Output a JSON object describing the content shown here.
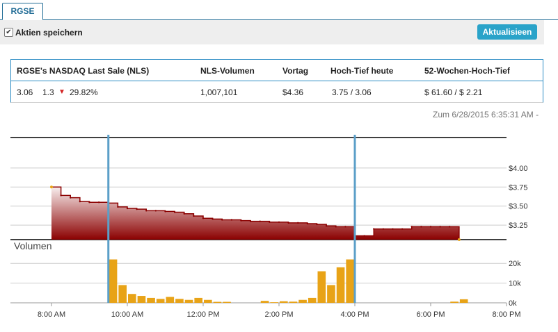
{
  "tab": {
    "label": "RGSE"
  },
  "toolbar": {
    "checkbox_label": "Aktien speichern",
    "checked": true,
    "refresh_label": "Aktualisieen"
  },
  "quote": {
    "headers": [
      "RGSE's NASDAQ Last Sale (NLS)",
      "NLS-Volumen",
      "Vortag",
      "Hoch-Tief heute",
      "52-Wochen-Hoch-Tief"
    ],
    "last": "3.06",
    "change": "1.3",
    "change_pct": "29.82%",
    "volume": "1,007,101",
    "prev_close": "$4.36",
    "day_range": "3.75 / 3.06",
    "week52_range": "$ 61.60 / $ 2.21"
  },
  "as_of": "Zum 6/28/2015 6:35:31 AM -",
  "colors": {
    "accent": "#1f6b95",
    "button": "#2aa3c9",
    "price_fill_dark": "#8b0000",
    "price_fill_light": "#f8eeee",
    "volume_bars": "#e8a317",
    "session_marker": "#5b9fc8",
    "down": "#d32222"
  },
  "chart_data": [
    {
      "type": "area",
      "title": "",
      "x": [
        "08:00",
        "08:15",
        "08:30",
        "08:45",
        "09:00",
        "09:15",
        "09:30",
        "09:45",
        "10:00",
        "10:15",
        "10:30",
        "10:45",
        "11:00",
        "11:15",
        "11:30",
        "11:45",
        "12:00",
        "12:15",
        "12:30",
        "12:45",
        "13:00",
        "13:15",
        "13:30",
        "13:45",
        "14:00",
        "14:15",
        "14:30",
        "14:45",
        "15:00",
        "15:15",
        "15:30",
        "15:45",
        "16:00",
        "16:15",
        "16:30",
        "16:45",
        "17:00",
        "17:15",
        "17:30",
        "17:45",
        "18:00",
        "18:15",
        "18:30",
        "18:45"
      ],
      "values": [
        3.75,
        3.64,
        3.61,
        3.56,
        3.55,
        3.55,
        3.54,
        3.49,
        3.47,
        3.46,
        3.44,
        3.44,
        3.43,
        3.42,
        3.4,
        3.37,
        3.34,
        3.33,
        3.32,
        3.32,
        3.31,
        3.3,
        3.3,
        3.29,
        3.29,
        3.28,
        3.28,
        3.27,
        3.26,
        3.24,
        3.23,
        3.23,
        3.11,
        3.11,
        3.2,
        3.2,
        3.2,
        3.2,
        3.23,
        3.23,
        3.23,
        3.23,
        3.23,
        3.06
      ],
      "yticks": [
        "$3.25",
        "$3.50",
        "$3.75",
        "$4.00"
      ],
      "ylim": [
        3.06,
        4.4
      ],
      "grid": true
    },
    {
      "type": "bar",
      "title": "Volumen",
      "x": [
        "08:00",
        "08:15",
        "08:30",
        "08:45",
        "09:00",
        "09:15",
        "09:30",
        "09:45",
        "10:00",
        "10:15",
        "10:30",
        "10:45",
        "11:00",
        "11:15",
        "11:30",
        "11:45",
        "12:00",
        "12:15",
        "12:30",
        "12:45",
        "13:00",
        "13:15",
        "13:30",
        "13:45",
        "14:00",
        "14:15",
        "14:30",
        "14:45",
        "15:00",
        "15:15",
        "15:30",
        "15:45",
        "16:00",
        "16:15",
        "16:30",
        "16:45",
        "17:00",
        "17:15",
        "17:30",
        "17:45",
        "18:00",
        "18:15",
        "18:30",
        "18:45"
      ],
      "values": [
        0,
        0,
        0,
        0,
        0,
        0,
        22000,
        9000,
        4500,
        3500,
        2500,
        2000,
        3000,
        2000,
        1500,
        2500,
        1500,
        500,
        500,
        0,
        0,
        0,
        1000,
        300,
        800,
        600,
        1500,
        2500,
        16000,
        9000,
        18000,
        22000,
        0,
        0,
        0,
        0,
        0,
        0,
        0,
        0,
        0,
        0,
        600,
        1800
      ],
      "yticks": [
        "0k",
        "10k",
        "20k"
      ],
      "ylim": [
        0,
        25000
      ],
      "xticks": [
        "8:00 AM",
        "10:00 AM",
        "12:00 PM",
        "2:00 PM",
        "4:00 PM",
        "6:00 PM",
        "8:00 PM"
      ],
      "grid": true
    }
  ]
}
